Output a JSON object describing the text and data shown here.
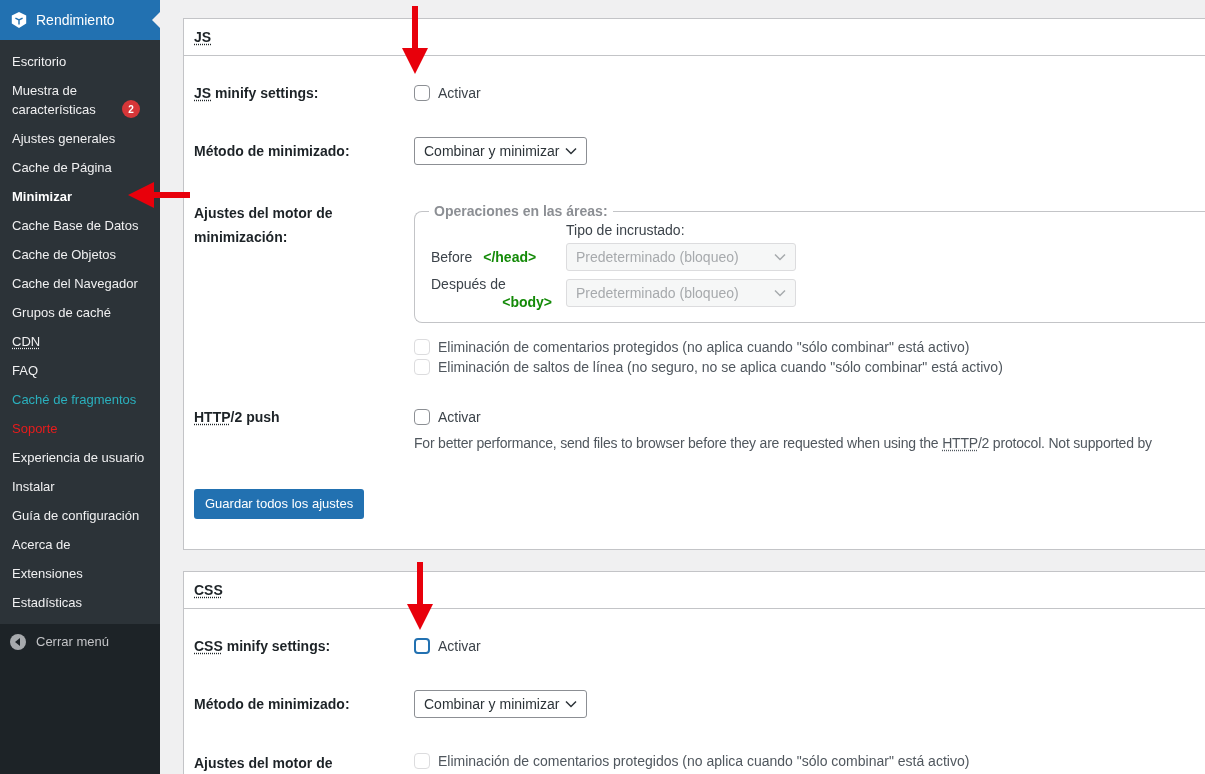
{
  "sidebar": {
    "header": {
      "label": "Rendimiento"
    },
    "items": [
      {
        "label": "Escritorio",
        "selected": false,
        "kind": "normal"
      },
      {
        "label": "Muestra de características",
        "selected": false,
        "kind": "normal",
        "badge": "2"
      },
      {
        "label": "Ajustes generales",
        "selected": false,
        "kind": "normal"
      },
      {
        "label": "Cache de Página",
        "selected": false,
        "kind": "normal"
      },
      {
        "label": "Minimizar",
        "selected": true,
        "kind": "normal"
      },
      {
        "label": "Cache Base de Datos",
        "selected": false,
        "kind": "normal"
      },
      {
        "label": "Cache de Objetos",
        "selected": false,
        "kind": "normal"
      },
      {
        "label": "Cache del Navegador",
        "selected": false,
        "kind": "normal"
      },
      {
        "label": "Grupos de caché",
        "selected": false,
        "kind": "normal"
      },
      {
        "label": "CDN",
        "selected": false,
        "kind": "abbr"
      },
      {
        "label": "FAQ",
        "selected": false,
        "kind": "normal"
      },
      {
        "label": "Caché de fragmentos",
        "selected": false,
        "kind": "highlight"
      },
      {
        "label": "Soporte",
        "selected": false,
        "kind": "alert"
      },
      {
        "label": "Experiencia de usuario",
        "selected": false,
        "kind": "normal"
      },
      {
        "label": "Instalar",
        "selected": false,
        "kind": "normal"
      },
      {
        "label": "Guía de configuración",
        "selected": false,
        "kind": "normal"
      },
      {
        "label": "Acerca de",
        "selected": false,
        "kind": "normal"
      },
      {
        "label": "Extensiones",
        "selected": false,
        "kind": "normal"
      },
      {
        "label": "Estadísticas",
        "selected": false,
        "kind": "normal"
      }
    ],
    "collapse": {
      "label": "Cerrar menú"
    }
  },
  "sections": [
    {
      "title": "JS",
      "rows": [
        {
          "kind": "checkbox",
          "label": {
            "abbr": "JS",
            "rest": " minify settings:"
          },
          "checked": false,
          "focused": false,
          "option": "Activar"
        },
        {
          "kind": "select",
          "label": {
            "rest": "Método de minimizado:"
          },
          "value": "Combinar y minimizar"
        },
        {
          "kind": "engine",
          "label": {
            "rest": "Ajustes del motor de minimización:"
          },
          "fieldset": {
            "legend": "Operaciones en las áreas:",
            "column_heading": "Tipo de incrustado:",
            "rows": [
              {
                "label": "Before",
                "tag": "</head>",
                "value": "Predeterminado (bloqueo)",
                "disabled": true
              },
              {
                "label": "Después de",
                "tag": "<body>",
                "value": "Predeterminado (bloqueo)",
                "disabled": true
              }
            ]
          },
          "options": [
            {
              "label": "Eliminación de comentarios protegidos (no aplica cuando \"sólo combinar\" está activo)",
              "checked": false,
              "disabled": true
            },
            {
              "label": "Eliminación de saltos de línea (no seguro, no se aplica cuando \"sólo combinar\" está activo)",
              "checked": false,
              "disabled": true
            }
          ]
        },
        {
          "kind": "checkbox",
          "label": {
            "abbr": "HTTP",
            "rest": "/2 push"
          },
          "checked": false,
          "focused": false,
          "option": "Activar",
          "description": {
            "before": "For better performance, send files to browser before they are requested when using the ",
            "abbr": "HTTP",
            "after": "/2 protocol. Not supported by"
          }
        }
      ],
      "button": "Guardar todos los ajustes"
    },
    {
      "title": "CSS",
      "rows": [
        {
          "kind": "checkbox",
          "label": {
            "abbr": "CSS",
            "rest": " minify settings:"
          },
          "checked": false,
          "focused": true,
          "option": "Activar"
        },
        {
          "kind": "select",
          "label": {
            "rest": "Método de minimizado:"
          },
          "value": "Combinar y minimizar"
        },
        {
          "kind": "engine",
          "label": {
            "rest": "Ajustes del motor de"
          },
          "options": [
            {
              "label": "Eliminación de comentarios protegidos (no aplica cuando \"sólo combinar\" está activo)",
              "checked": false,
              "disabled": true
            }
          ]
        }
      ]
    }
  ]
}
